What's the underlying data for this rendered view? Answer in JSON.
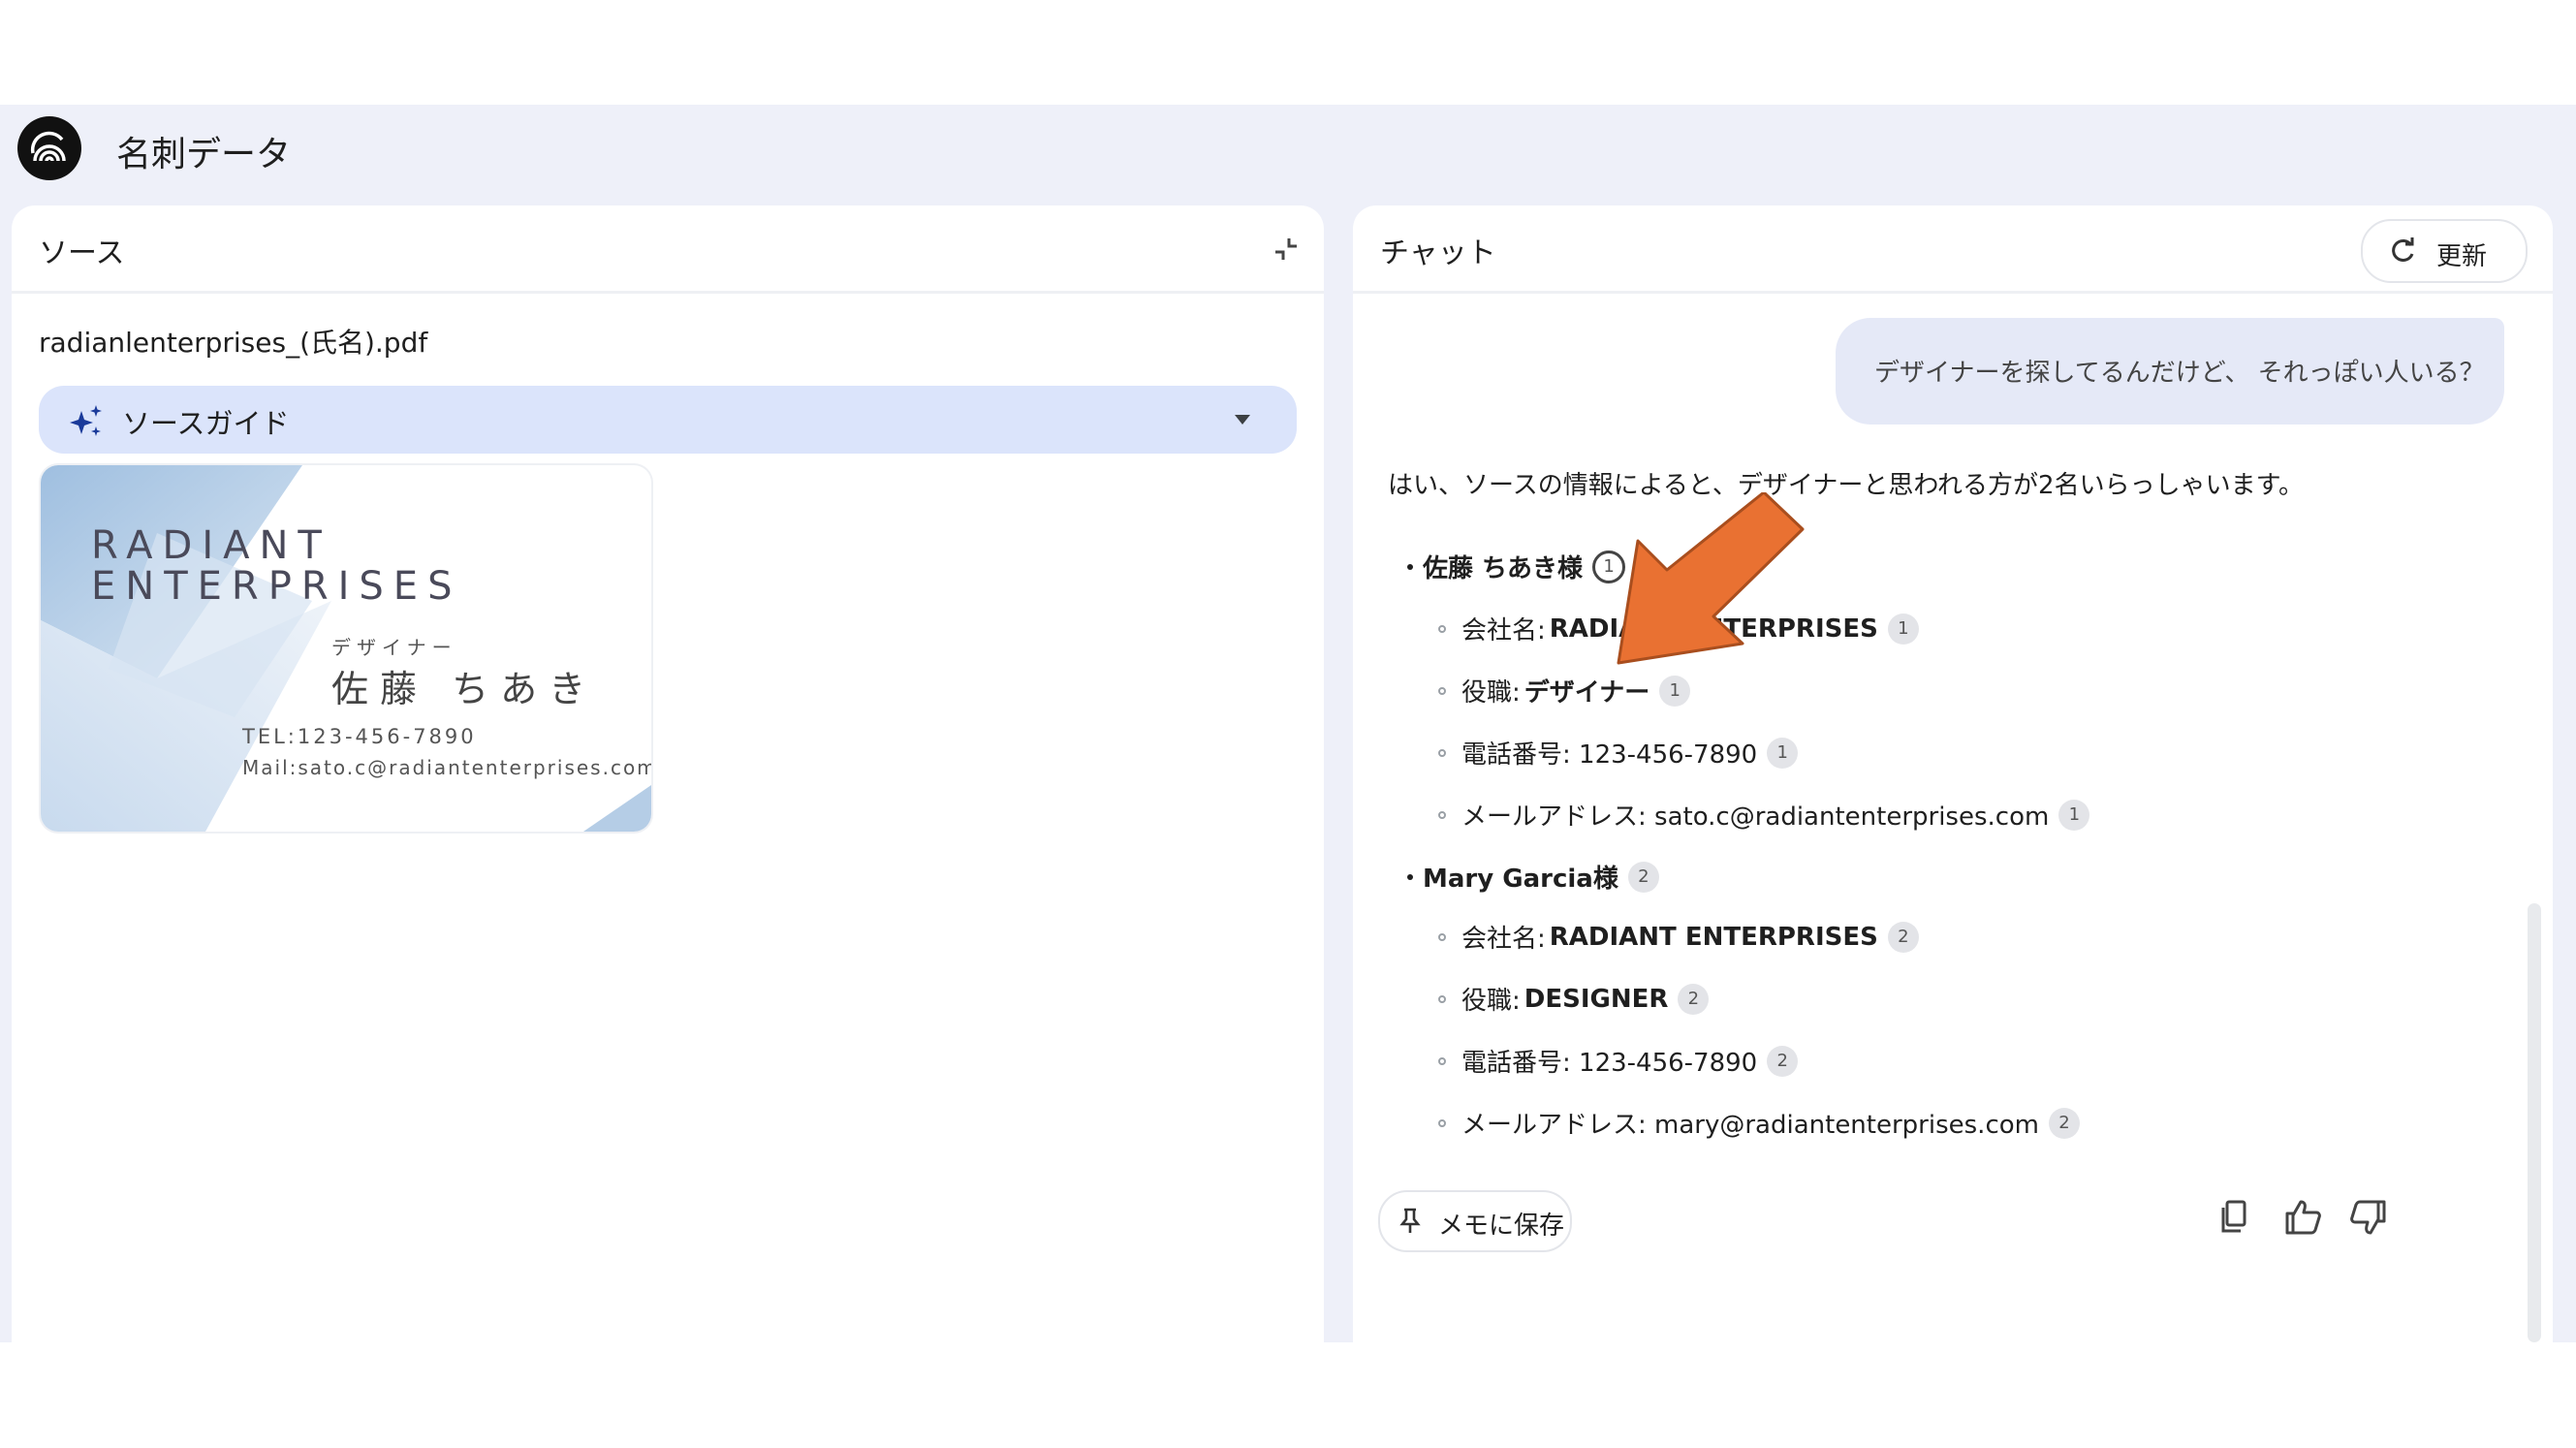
{
  "app": {
    "title": "名刺データ"
  },
  "source_panel": {
    "title": "ソース",
    "filename": "radianlenterprises_(氏名).pdf",
    "guide_label": "ソースガイド"
  },
  "business_card": {
    "company": "RADIANT ENTERPRISES",
    "role": "デザイナー",
    "name": "佐藤 ちあき",
    "tel": "TEL:123-456-7890",
    "mail": "Mail:sato.c@radiantenterprises.com"
  },
  "chat_panel": {
    "title": "チャット",
    "refresh_label": "更新",
    "user_message": "デザイナーを探してるんだけど、 それっぽい人いる？",
    "answer_intro": "はい、ソースの情報によると、デザイナーと思われる方が2名いらっしゃいます。",
    "people": [
      {
        "name": "佐藤 ちあき様",
        "cite": "1",
        "company_label": "会社名: ",
        "company_value": "RADIANT ENTERPRISES",
        "role_label": "役職: ",
        "role_value": "デザイナー",
        "phone": "電話番号: 123-456-7890",
        "email": "メールアドレス: sato.c@radiantenterprises.com"
      },
      {
        "name": "Mary Garcia様",
        "cite": "2",
        "company_label": "会社名: ",
        "company_value": "RADIANT ENTERPRISES",
        "role_label": "役職: ",
        "role_value": "DESIGNER",
        "phone": "電話番号: 123-456-7890",
        "email": "メールアドレス: mary@radiantenterprises.com"
      }
    ],
    "save_label": "メモに保存"
  },
  "colors": {
    "app_bg": "#eef0f9",
    "guide_bg": "#dbe4fb",
    "bubble_bg": "#e5e9f7",
    "arrow": "#e97132"
  },
  "icons": [
    "app-logo-icon",
    "collapse-icon",
    "sparkle-icon",
    "chevron-down-icon",
    "refresh-icon",
    "pin-icon",
    "copy-icon",
    "thumbs-up-icon",
    "thumbs-down-icon"
  ]
}
